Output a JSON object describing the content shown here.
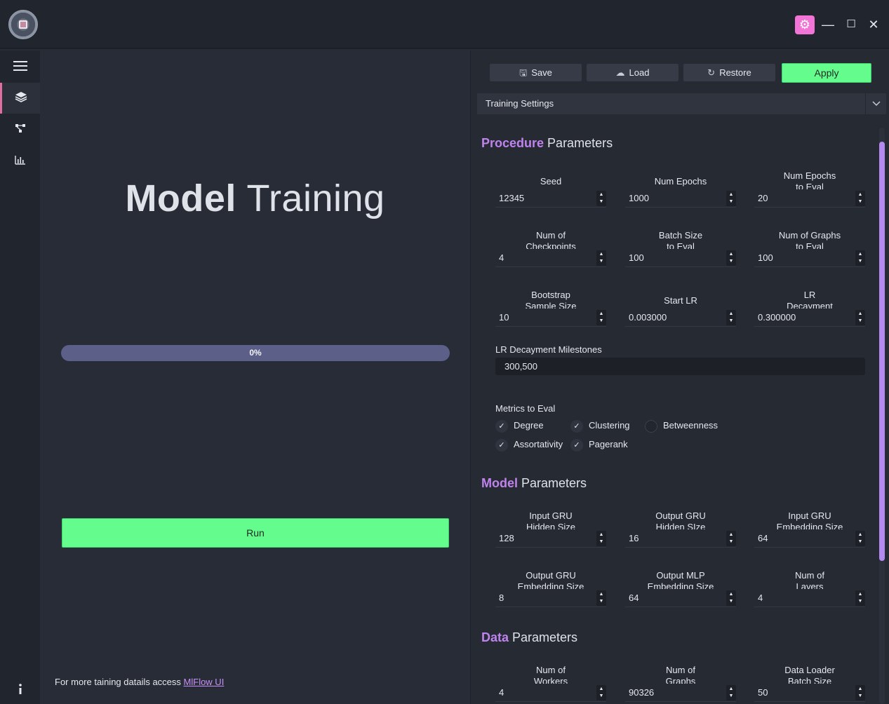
{
  "window": {
    "settings_icon": "gear-icon",
    "minimize": "—",
    "maximize": "☐",
    "close": "✕"
  },
  "sidebar": {
    "items": [
      {
        "icon": "hamburger-menu-icon"
      },
      {
        "icon": "layers-icon",
        "active": true
      },
      {
        "icon": "graph-network-icon"
      },
      {
        "icon": "bar-chart-icon"
      },
      {
        "icon": "info-icon"
      }
    ]
  },
  "main": {
    "title_bold": "Model",
    "title_rest": "Training",
    "progress_label": "0%",
    "progress_value": 0,
    "run_label": "Run",
    "footer_text": "For more taining datails access ",
    "footer_link": "MlFlow UI"
  },
  "toolbar": {
    "save": "Save",
    "load": "Load",
    "restore": "Restore",
    "apply": "Apply"
  },
  "settings_combo": {
    "selected": "Training Settings"
  },
  "procedure": {
    "title_accent": "Procedure",
    "title_rest": " Parameters",
    "fields": [
      {
        "label": "Seed",
        "value": "12345"
      },
      {
        "label": "Num Epochs",
        "value": "1000"
      },
      {
        "label": "Num Epochs\nto Eval",
        "value": "20"
      },
      {
        "label": "Num of\nCheckpoints",
        "value": "4"
      },
      {
        "label": "Batch Size\nto Eval",
        "value": "100"
      },
      {
        "label": "Num of Graphs\nto Eval",
        "value": "100"
      },
      {
        "label": "Bootstrap\nSample Size",
        "value": "10"
      },
      {
        "label": "Start LR",
        "value": "0.003000"
      },
      {
        "label": "LR\nDecayment",
        "value": "0.300000"
      }
    ],
    "milestones_label": "LR Decayment Milestones",
    "milestones_value": "300,500",
    "metrics_label": "Metrics to Eval",
    "metrics": [
      {
        "label": "Degree",
        "checked": true
      },
      {
        "label": "Clustering",
        "checked": true
      },
      {
        "label": "Betweenness",
        "checked": false
      },
      {
        "label": "Assortativity",
        "checked": true
      },
      {
        "label": "Pagerank",
        "checked": true
      }
    ]
  },
  "model": {
    "title_accent": "Model",
    "title_rest": " Parameters",
    "fields": [
      {
        "label": "Input GRU\nHidden Size",
        "value": "128"
      },
      {
        "label": "Output GRU\nHidden SIze",
        "value": "16"
      },
      {
        "label": "Input GRU\nEmbedding Size",
        "value": "64"
      },
      {
        "label": "Output GRU\nEmbedding Size",
        "value": "8"
      },
      {
        "label": "Output MLP\nEmbedding Size",
        "value": "64"
      },
      {
        "label": "Num of\nLayers",
        "value": "4"
      }
    ]
  },
  "data": {
    "title_accent": "Data",
    "title_rest": " Parameters",
    "fields": [
      {
        "label": "Num of\nWorkers",
        "value": "4"
      },
      {
        "label": "Num of\nGraphs",
        "value": "90326"
      },
      {
        "label": "Data Loader\nBatch Size",
        "value": "50"
      }
    ]
  },
  "colors": {
    "accent_purple": "#c083ee",
    "run_green": "#64fd8d",
    "progress_bg": "#5c5f88",
    "gear_pink": "#f274d6"
  }
}
